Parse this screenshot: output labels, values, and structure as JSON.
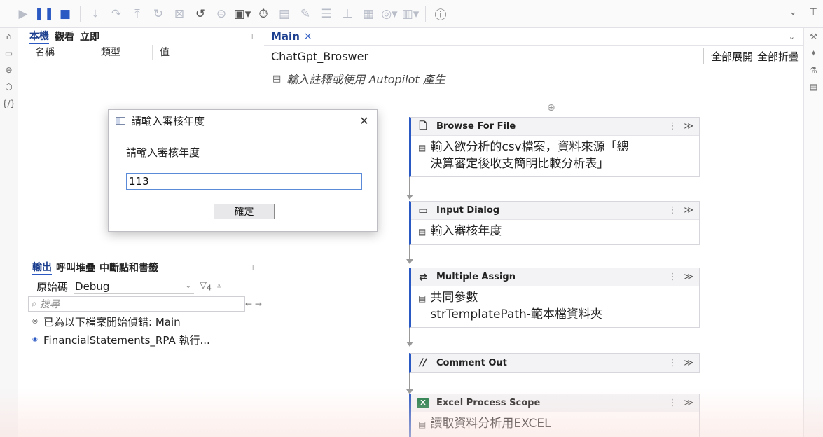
{
  "toolbar": {
    "buttons": [
      "play-icon",
      "pause-icon",
      "stop-icon",
      "step-into-icon",
      "step-over-icon",
      "step-out-icon",
      "restart-icon",
      "clear-icon",
      "retry-icon",
      "breakpoints-icon",
      "highlight-icon",
      "slow-step-icon",
      "settings-icon",
      "pen-icon",
      "list-icon",
      "tree-icon",
      "image-icon",
      "focus-icon",
      "columns-icon",
      "info-icon"
    ]
  },
  "variables_panel": {
    "tabs": [
      "本機",
      "觀看",
      "立即"
    ],
    "columns": [
      "名稱",
      "類型",
      "值"
    ]
  },
  "output_panel": {
    "tabs": [
      "輸出",
      "呼叫堆疊",
      "中斷點和書籤"
    ],
    "filter_label": "原始碼",
    "filter_value": "Debug",
    "filter_count": "4",
    "search_placeholder": "搜尋",
    "logs": [
      {
        "text": "已為以下檔案開始偵錯: Main",
        "level": "trace"
      },
      {
        "text": "FinancialStatements_RPA 執行...",
        "level": "info"
      }
    ]
  },
  "designer": {
    "tab_label": "Main",
    "workflow_name": "ChatGpt_Broswer",
    "expand_all": "全部展開",
    "collapse_all": "全部折疊",
    "annotation_hint": "輸入註釋或使用 Autopilot 產生",
    "activities": [
      {
        "title": "Browse For File",
        "icon": "browse-file-icon",
        "body_lines": [
          "輸入欲分析的csv檔案，資料來源「總",
          "決算審定後收支簡明比較分析表」"
        ]
      },
      {
        "title": "Input Dialog",
        "icon": "input-dialog-icon",
        "body_lines": [
          "輸入審核年度"
        ]
      },
      {
        "title": "Multiple Assign",
        "icon": "multiple-assign-icon",
        "body_lines": [
          "共同參數",
          "strTemplatePath-範本檔資料夾"
        ]
      },
      {
        "title": "Comment Out",
        "icon": "comment-out-icon",
        "body_lines": []
      },
      {
        "title": "Excel Process Scope",
        "icon": "excel-icon",
        "body_lines": [
          "讀取資料分析用EXCEL"
        ]
      }
    ]
  },
  "dialog": {
    "title": "請輸入審核年度",
    "label": "請輸入審核年度",
    "input_value": "113",
    "ok_label": "確定"
  },
  "colors": {
    "accent": "#2b59c3",
    "tab_active": "#1d3f8f",
    "excel_green": "#1e7a45"
  }
}
